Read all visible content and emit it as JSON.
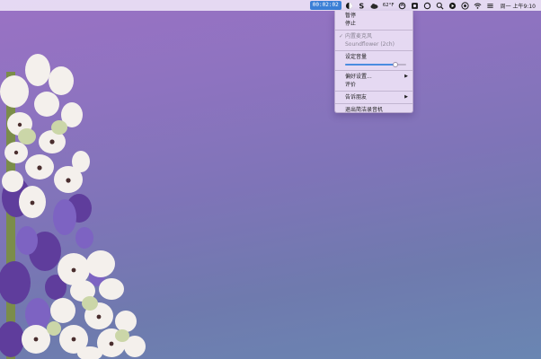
{
  "menubar": {
    "recorder_timer": "00:02:02",
    "temperature": "62°F",
    "clock": "周一 上午9:10",
    "icons": [
      "recorder-icon",
      "skype-icon",
      "cloud-icon",
      "stats-icon",
      "shield-icon",
      "sync-icon",
      "search-icon",
      "play-icon",
      "creative-cloud-icon",
      "wifi-icon",
      "menu-icon"
    ]
  },
  "dropdown": {
    "pause": "暂停",
    "stop": "停止",
    "input_builtin": "内置麦克风",
    "input_soundflower": "Soundflower (2ch)",
    "volume_label": "设定音量",
    "preferences": "偏好设置...",
    "rate": "评价",
    "tell_friends": "告诉朋友",
    "quit": "退出简洁录音机",
    "check_mark": "✓",
    "submenu_arrow": "▶"
  },
  "volume": {
    "level": 0.82
  },
  "colors": {
    "accent": "#3b7fd6",
    "slider_fill": "#4a8ce0"
  }
}
